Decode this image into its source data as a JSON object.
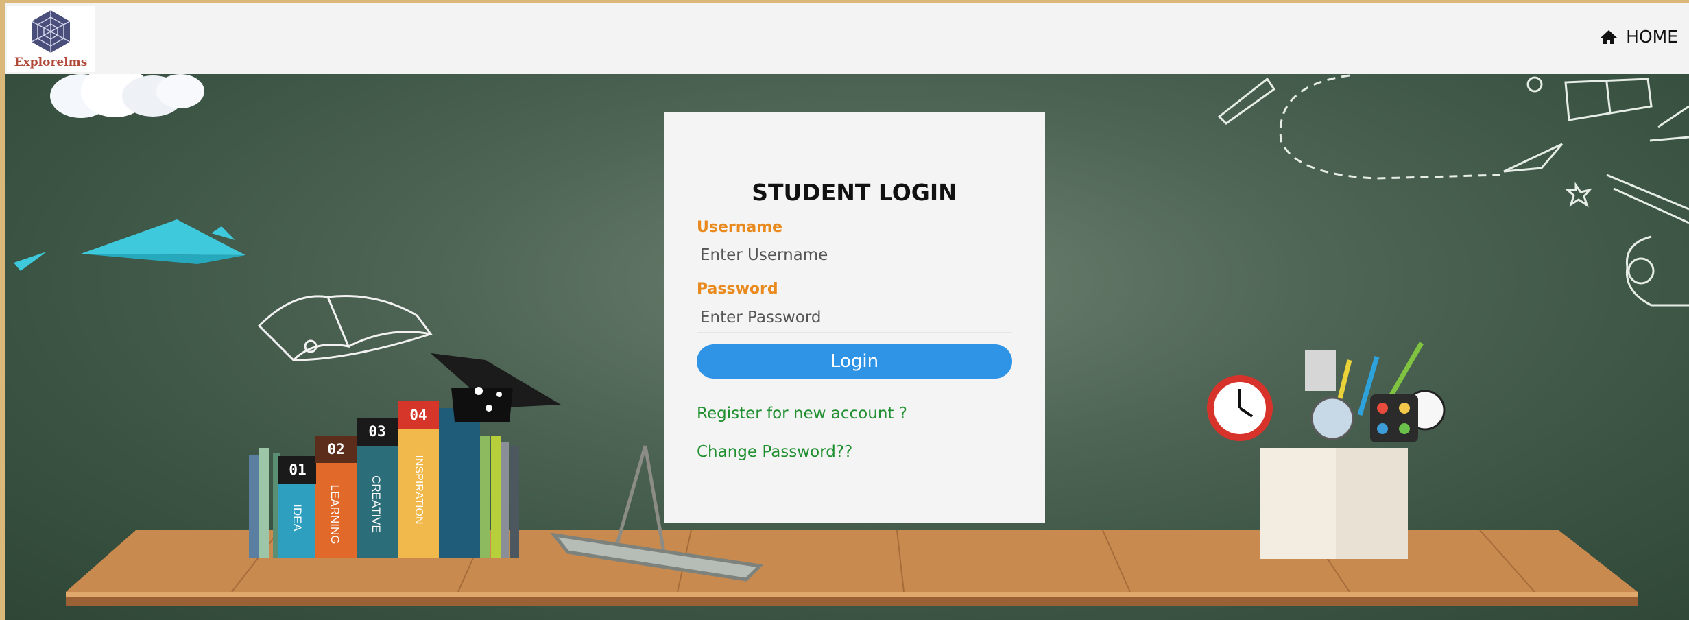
{
  "brand": {
    "name": "Explorelms"
  },
  "nav": {
    "home_label": "HOME"
  },
  "login": {
    "title": "STUDENT LOGIN",
    "username_label": "Username",
    "username_placeholder": "Enter Username",
    "password_label": "Password",
    "password_placeholder": "Enter Password",
    "submit_label": "Login",
    "register_link": "Register for new account ?",
    "change_password_link": "Change Password??"
  },
  "decor": {
    "book_labels": [
      "01",
      "02",
      "03",
      "04"
    ],
    "book_spines": [
      "IDEA",
      "LEARNING",
      "CREATIVE",
      "INSPIRATION"
    ]
  },
  "colors": {
    "accent_orange": "#e98a1e",
    "button_blue": "#2f93e6",
    "link_green": "#1f8f2f",
    "board_green": "#4f6555"
  }
}
